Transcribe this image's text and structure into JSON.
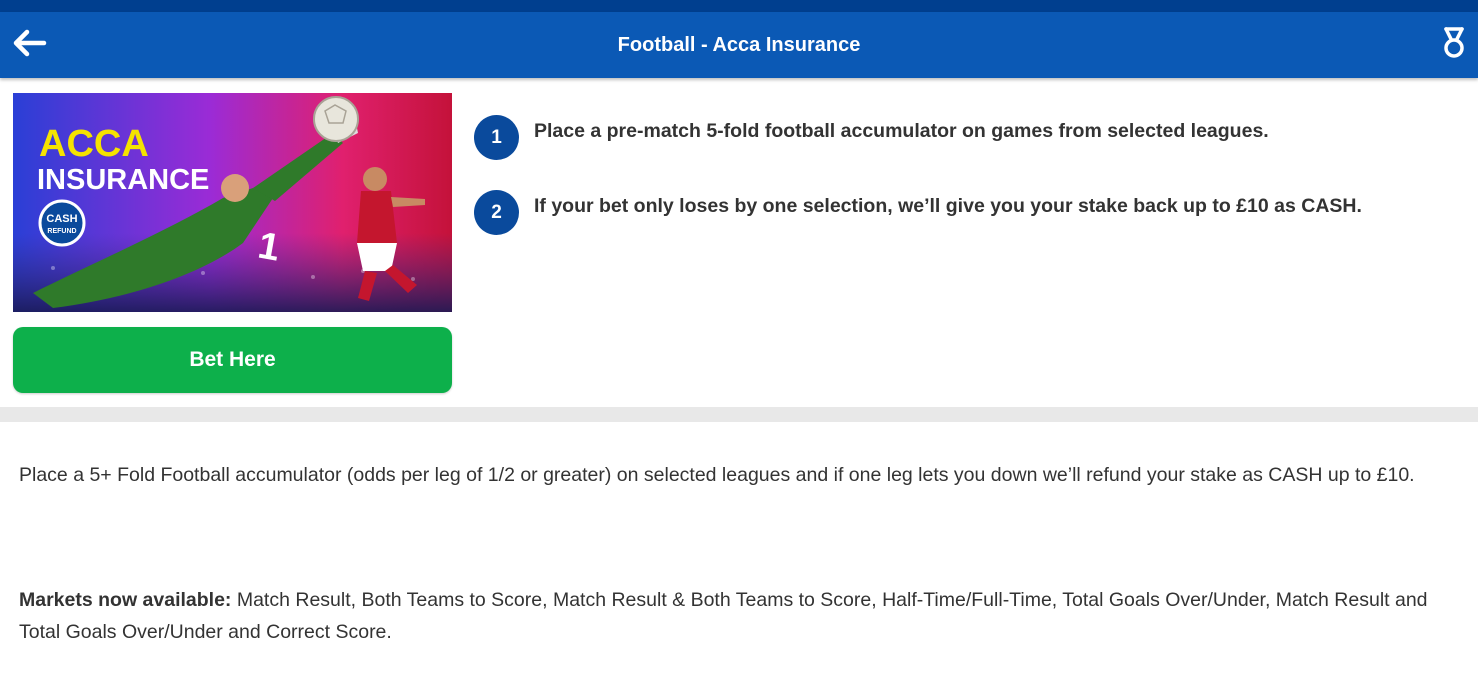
{
  "header": {
    "title": "Football - Acca Insurance",
    "back_icon": "arrow-left-icon",
    "right_icon": "medal-icon",
    "color": "#0b59b5"
  },
  "promo": {
    "headline_1": "ACCA",
    "headline_2": "INSURANCE",
    "badge_1": "CASH",
    "badge_2": "REFUND",
    "shirt_number": "1"
  },
  "bet_button": {
    "label": "Bet Here",
    "color": "#0db04b"
  },
  "steps": [
    {
      "number": "1",
      "text": "Place a pre-match 5-fold football accumulator on games from selected leagues."
    },
    {
      "number": "2",
      "text": "If your bet only loses by one selection, we’ll give you your stake back up to £10 as CASH."
    }
  ],
  "description": "Place a 5+ Fold Football accumulator (odds per leg of 1/2 or greater) on selected leagues and if one leg lets you down we’ll refund your stake as CASH up to £10.",
  "markets": {
    "label": "Markets now available:",
    "text": " Match Result, Both Teams to Score, Match Result & Both Teams to Score, Half-Time/Full-Time, Total Goals Over/Under, Match Result and Total Goals Over/Under and Correct Score."
  }
}
